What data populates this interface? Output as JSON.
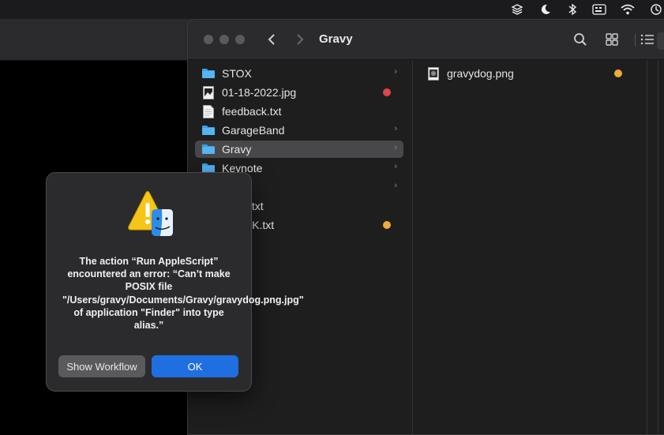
{
  "finder": {
    "title": "Gravy",
    "sidebar_items": [
      {
        "label": "STOX",
        "kind": "folder",
        "chevron": "›"
      },
      {
        "label": "01-18-2022.jpg",
        "kind": "image",
        "tag_color": "#e0454a"
      },
      {
        "label": "feedback.txt",
        "kind": "text"
      },
      {
        "label": "GarageBand",
        "kind": "folder",
        "chevron": "›"
      },
      {
        "label": "Gravy",
        "kind": "folder",
        "chevron": "›",
        "selected": true
      },
      {
        "label": "Keynote",
        "kind": "folder",
        "chevron": "›"
      },
      {
        "label": "",
        "kind": "folder",
        "chevron": "›"
      },
      {
        "label": ".txt",
        "kind": "text"
      },
      {
        "label": "CK.txt",
        "kind": "text",
        "tag_color": "#f0a93a"
      }
    ],
    "content_items": [
      {
        "label": "gravydog.png",
        "kind": "image",
        "tag_color": "#f0a93a"
      }
    ]
  },
  "dialog": {
    "message": "The action “Run AppleScript” encountered an error: “Can’t make POSIX file \"/Users/gravy/Documents/Gravy/gravydog.png.jpg\" of application \"Finder\" into type alias.”",
    "show_workflow_label": "Show Workflow",
    "ok_label": "OK"
  },
  "icons": {
    "menubar": [
      "shortcuts-icon",
      "moon-icon",
      "bluetooth-icon",
      "keyboard-input-icon",
      "wifi-icon",
      "time-machine-icon"
    ]
  },
  "colors": {
    "accent": "#1f6fe0",
    "folder": "#3aa0e8",
    "tag_red": "#e0454a",
    "tag_orange": "#f0a93a"
  }
}
